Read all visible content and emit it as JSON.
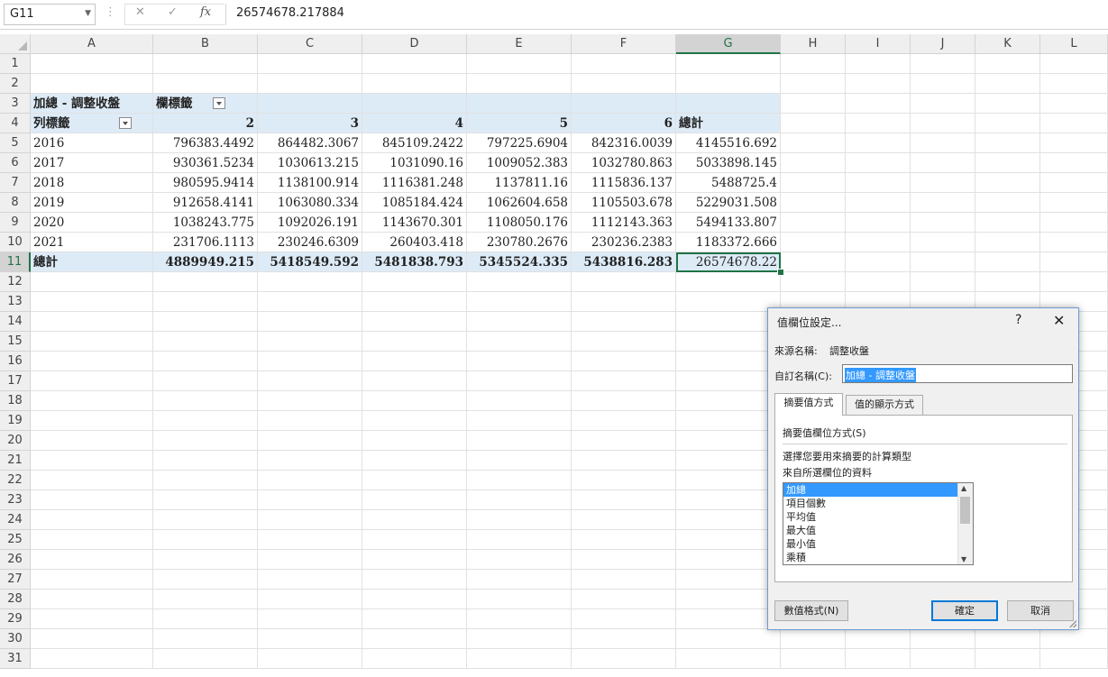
{
  "formula_bar": {
    "name_box": "G11",
    "cancel_icon": "✕",
    "enter_icon": "✓",
    "fx_label": "fx",
    "formula": "26574678.217884"
  },
  "columns": [
    "A",
    "B",
    "C",
    "D",
    "E",
    "F",
    "G",
    "H",
    "I",
    "J",
    "K",
    "L"
  ],
  "selected_column": "G",
  "rows": [
    "1",
    "2",
    "3",
    "4",
    "5",
    "6",
    "7",
    "8",
    "9",
    "10",
    "11",
    "12",
    "13",
    "14",
    "15",
    "16",
    "17",
    "18",
    "19",
    "20",
    "21",
    "22",
    "23",
    "24",
    "25",
    "26",
    "27",
    "28",
    "29",
    "30",
    "31"
  ],
  "selected_row": "11",
  "pivot": {
    "title": "加總 - 調整收盤",
    "col_labels_caption": "欄標籤",
    "row_labels_caption": "列標籤",
    "col_headers": [
      "2",
      "3",
      "4",
      "5",
      "6"
    ],
    "grand_total_label": "總計",
    "data_rows": [
      {
        "label": "2016",
        "values": [
          "796383.4492",
          "864482.3067",
          "845109.2422",
          "797225.6904",
          "842316.0039",
          "4145516.692"
        ]
      },
      {
        "label": "2017",
        "values": [
          "930361.5234",
          "1030613.215",
          "1031090.16",
          "1009052.383",
          "1032780.863",
          "5033898.145"
        ]
      },
      {
        "label": "2018",
        "values": [
          "980595.9414",
          "1138100.914",
          "1116381.248",
          "1137811.16",
          "1115836.137",
          "5488725.4"
        ]
      },
      {
        "label": "2019",
        "values": [
          "912658.4141",
          "1063080.334",
          "1085184.424",
          "1062604.658",
          "1105503.678",
          "5229031.508"
        ]
      },
      {
        "label": "2020",
        "values": [
          "1038243.775",
          "1092026.191",
          "1143670.301",
          "1108050.176",
          "1112143.363",
          "5494133.807"
        ]
      },
      {
        "label": "2021",
        "values": [
          "231706.1113",
          "230246.6309",
          "260403.418",
          "230780.2676",
          "230236.2383",
          "1183372.666"
        ]
      }
    ],
    "total_values": [
      "4889949.215",
      "5418549.592",
      "5481838.793",
      "5345524.335",
      "5438816.283",
      "26574678.22"
    ]
  },
  "dialog": {
    "title": "值欄位設定...",
    "help": "?",
    "close": "✕",
    "source_label": "來源名稱:",
    "source_value": "調整收盤",
    "custom_label": "自訂名稱(C):",
    "custom_value": "加總 - 調整收盤",
    "tabs": [
      "摘要值方式",
      "值的顯示方式"
    ],
    "section_label": "摘要值欄位方式(S)",
    "description_line1": "選擇您要用來摘要的計算類型",
    "description_line2": "來自所選欄位的資料",
    "list_items": [
      "加總",
      "項目個數",
      "平均值",
      "最大值",
      "最小值",
      "乘積"
    ],
    "selected_item": "加總",
    "number_format_button": "數值格式(N)",
    "ok_button": "確定",
    "cancel_button": "取消"
  }
}
